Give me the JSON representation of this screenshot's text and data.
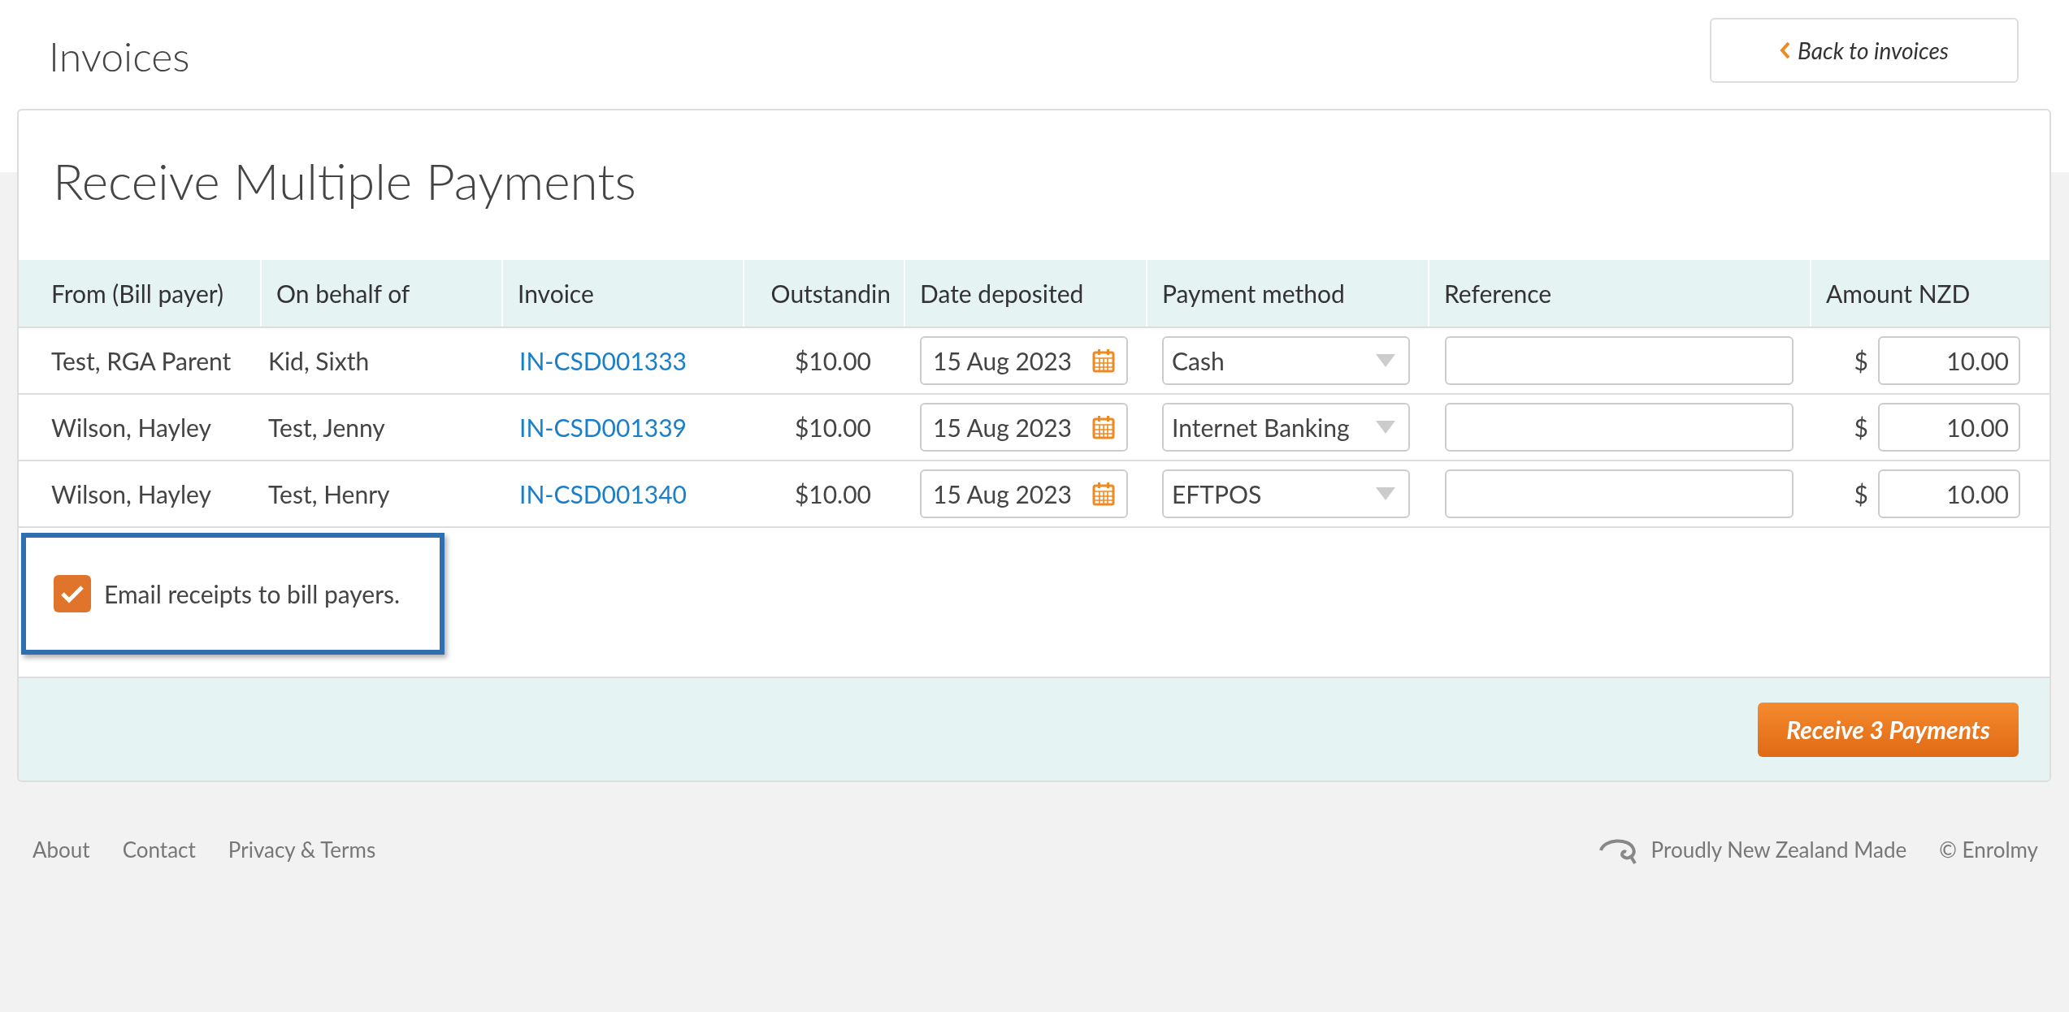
{
  "page_title": "Invoices",
  "back_button": {
    "label": "Back to invoices"
  },
  "card_title": "Receive Multiple Payments",
  "columns": [
    "From (Bill payer)",
    "On behalf of",
    "Invoice",
    "Outstandin",
    "Date deposited",
    "Payment method",
    "Reference",
    "Amount NZD"
  ],
  "rows": [
    {
      "from": "Test, RGA Parent",
      "on_behalf_of": "Kid, Sixth",
      "invoice": "IN-CSD001333",
      "outstanding": "$10.00",
      "date": "15 Aug 2023",
      "method": "Cash",
      "currency": "$",
      "amount": "10.00"
    },
    {
      "from": "Wilson, Hayley",
      "on_behalf_of": "Test, Jenny",
      "invoice": "IN-CSD001339",
      "outstanding": "$10.00",
      "date": "15 Aug 2023",
      "method": "Internet Banking",
      "currency": "$",
      "amount": "10.00"
    },
    {
      "from": "Wilson, Hayley",
      "on_behalf_of": "Test, Henry",
      "invoice": "IN-CSD001340",
      "outstanding": "$10.00",
      "date": "15 Aug 2023",
      "method": "EFTPOS",
      "currency": "$",
      "amount": "10.00"
    }
  ],
  "email_receipts": {
    "label": "Email receipts to bill payers.",
    "checked": true
  },
  "submit_button": {
    "label": "Receive 3 Payments"
  },
  "footer": {
    "links": [
      "About",
      "Contact",
      "Privacy & Terms"
    ],
    "made_in": "Proudly New Zealand Made",
    "copyright": "© Enrolmy"
  }
}
